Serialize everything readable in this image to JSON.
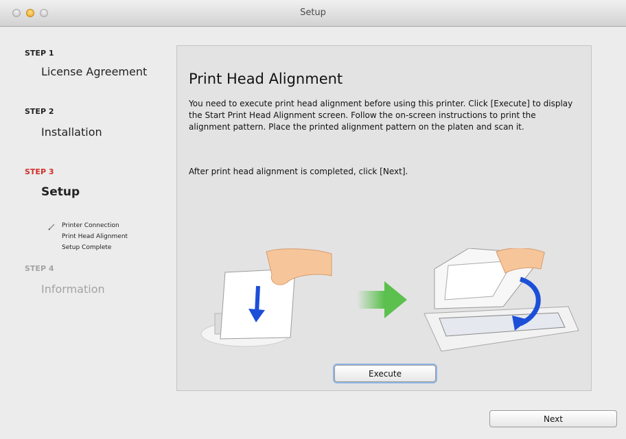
{
  "window": {
    "title": "Setup"
  },
  "sidebar": {
    "steps": [
      {
        "label": "STEP 1",
        "title": "License Agreement",
        "state": "done"
      },
      {
        "label": "STEP 2",
        "title": "Installation",
        "state": "done"
      },
      {
        "label": "STEP 3",
        "title": "Setup",
        "state": "active",
        "substeps": [
          "Printer Connection",
          "Print Head Alignment",
          "Setup Complete"
        ]
      },
      {
        "label": "STEP 4",
        "title": "Information",
        "state": "pending"
      }
    ]
  },
  "main": {
    "heading": "Print Head Alignment",
    "paragraph1": "You need to execute print head alignment before using this printer. Click [Execute] to display the Start Print Head Alignment screen. Follow the on-screen instructions to print the alignment pattern. Place the printed alignment pattern on the platen and scan it.",
    "paragraph2": "After print head alignment is completed, click [Next].",
    "execute_label": "Execute"
  },
  "footer": {
    "next_label": "Next"
  },
  "colors": {
    "active_step": "#d2302a",
    "dim_step": "#a3a3a3",
    "arrow_green": "#5bc04d",
    "arrow_blue": "#1c4fd8"
  },
  "icons": {
    "current_substep": "pencil-icon"
  }
}
